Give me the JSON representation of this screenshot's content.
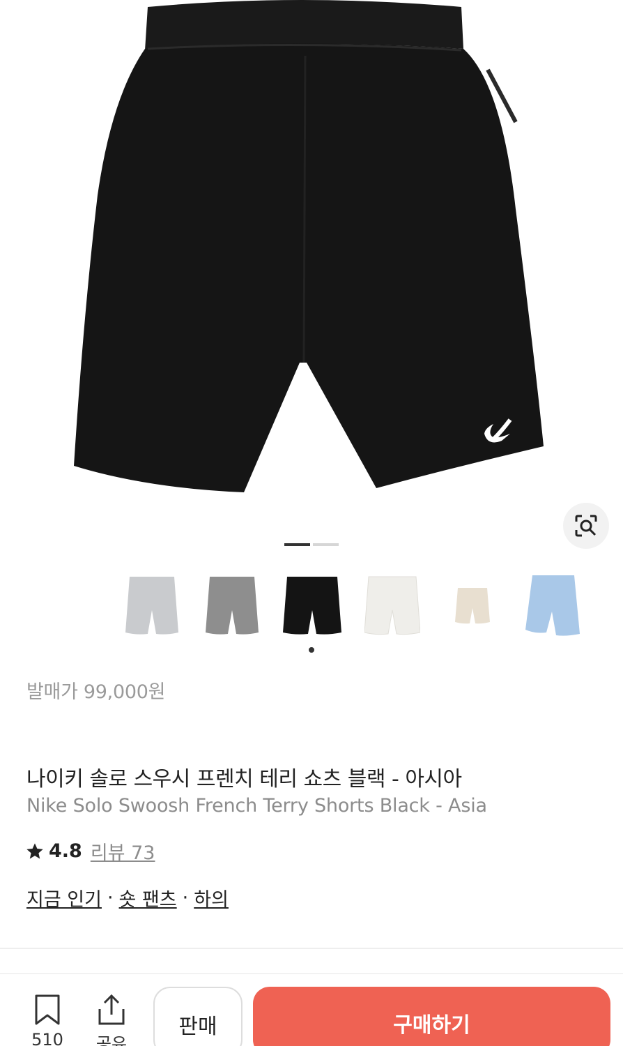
{
  "product": {
    "release_price": "발매가 99,000원",
    "name_ko": "나이키 솔로 스우시 프렌치 테리 쇼츠 블랙 - 아시아",
    "name_en": "Nike Solo Swoosh French Terry Shorts Black - Asia",
    "rating_score": "4.8",
    "reviews_label": "리뷰 73",
    "categories": [
      "지금 인기",
      "숏 팬츠",
      "하의"
    ],
    "category_separator": "·"
  },
  "gallery": {
    "main_image_icon": "shorts-image",
    "lens_icon": "image-search-icon",
    "page_indicator": {
      "current": 1,
      "total": 2
    },
    "thumbnails": [
      {
        "color_name": "light-grey",
        "color": "#c9cbce"
      },
      {
        "color_name": "grey",
        "color": "#8e8e8e"
      },
      {
        "color_name": "black",
        "color": "#141414"
      },
      {
        "color_name": "white",
        "color": "#efeeea"
      },
      {
        "color_name": "beige",
        "color": "#e8dfd0"
      },
      {
        "color_name": "light-blue",
        "color": "#a9c8e8"
      }
    ]
  },
  "bottom_bar": {
    "bookmark_count": "510",
    "share_label": "공유",
    "sell_label": "판매",
    "buy_label": "구매하기",
    "buy_color": "#ef6253"
  }
}
